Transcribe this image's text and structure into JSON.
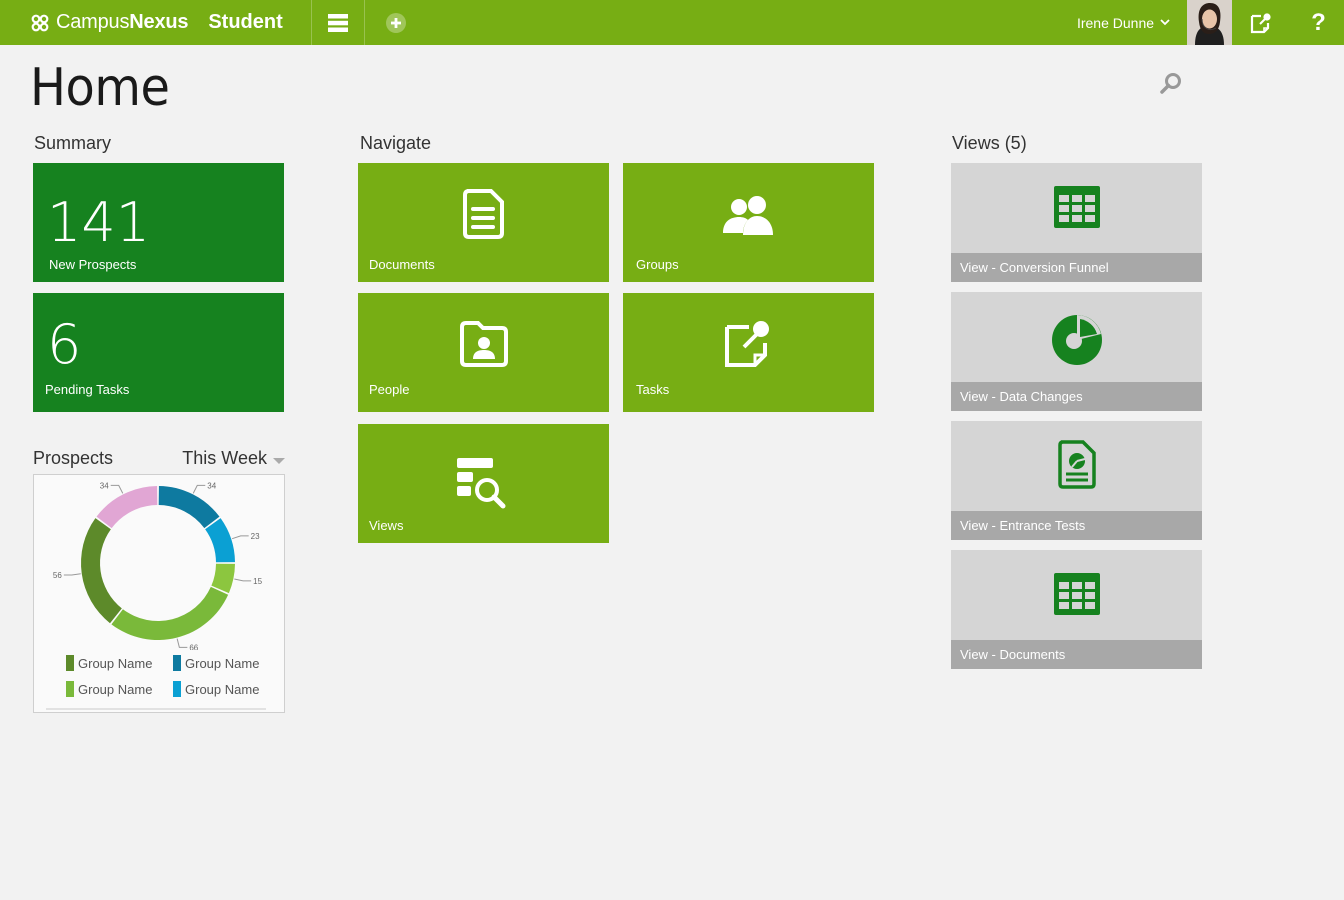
{
  "topbar": {
    "brand_campus": "Campus",
    "brand_nexus": "Nexus",
    "brand_product": "Student",
    "user_name": "Irene Dunne",
    "help_label": "?"
  },
  "page": {
    "title": "Home"
  },
  "summary": {
    "label": "Summary",
    "tiles": [
      {
        "value": "141",
        "label": "New Prospects"
      },
      {
        "value": "6",
        "label": "Pending Tasks"
      }
    ]
  },
  "navigate": {
    "label": "Navigate",
    "tiles": [
      {
        "label": "Documents",
        "icon": "document-icon"
      },
      {
        "label": "Groups",
        "icon": "groups-icon"
      },
      {
        "label": "People",
        "icon": "people-folder-icon"
      },
      {
        "label": "Tasks",
        "icon": "task-note-icon"
      },
      {
        "label": "Views",
        "icon": "views-search-icon"
      }
    ]
  },
  "views": {
    "label": "Views (5)",
    "tiles": [
      {
        "label": "View - Conversion Funnel",
        "icon": "table-icon"
      },
      {
        "label": "View - Data Changes",
        "icon": "pie-chart-icon"
      },
      {
        "label": "View - Entrance Tests",
        "icon": "report-doc-icon"
      },
      {
        "label": "View - Documents",
        "icon": "table-icon"
      }
    ]
  },
  "prospects": {
    "label": "Prospects",
    "range": "This Week"
  },
  "chart_data": {
    "type": "pie",
    "title": "",
    "series": [
      {
        "value": 34,
        "color": "#0e7aa0"
      },
      {
        "value": 23,
        "color": "#0ba0d3"
      },
      {
        "value": 15,
        "color": "#8cc63f"
      },
      {
        "value": 66,
        "color": "#7ab93a"
      },
      {
        "value": 56,
        "color": "#5d8a2a"
      },
      {
        "value": 34,
        "color": "#e1a6d4"
      }
    ],
    "legend": [
      {
        "name": "Group Name",
        "color": "#5d8a2a"
      },
      {
        "name": "Group Name",
        "color": "#0e7aa0"
      },
      {
        "name": "Group Name",
        "color": "#7ab93a"
      },
      {
        "name": "Group Name",
        "color": "#0ba0d3"
      }
    ]
  },
  "colors": {
    "brand_lime": "#77ae14",
    "summary_green": "#16821f",
    "view_tile": "#d5d5d5",
    "view_bar": "#a8a8a8"
  }
}
